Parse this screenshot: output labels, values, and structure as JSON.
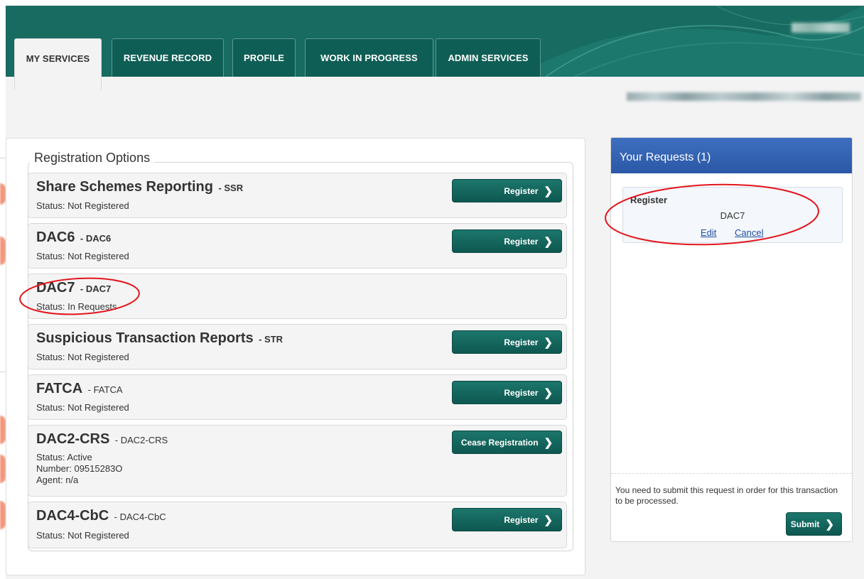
{
  "header": {
    "tabs": [
      {
        "label": "MY SERVICES",
        "active": true
      },
      {
        "label": "REVENUE RECORD",
        "active": false
      },
      {
        "label": "PROFILE",
        "active": false
      },
      {
        "label": "WORK IN PROGRESS",
        "active": false
      },
      {
        "label": "ADMIN SERVICES",
        "active": false
      }
    ]
  },
  "registration": {
    "legend": "Registration Options",
    "items": [
      {
        "name": "Share Schemes Reporting",
        "code": "- SSR",
        "status": "Status: Not Registered",
        "button": "Register"
      },
      {
        "name": "DAC6",
        "code": "- DAC6",
        "status": "Status: Not Registered",
        "button": "Register"
      },
      {
        "name": "DAC7",
        "code": "- DAC7",
        "status": "Status: In Requests"
      },
      {
        "name": "Suspicious Transaction Reports",
        "code": "- STR",
        "status": "Status: Not Registered",
        "button": "Register"
      },
      {
        "name": "FATCA",
        "code": "- FATCA",
        "status": "Status: Not Registered",
        "button": "Register"
      },
      {
        "name": "DAC2-CRS",
        "code": "- DAC2-CRS",
        "status": "Status: Active",
        "number": "Number: 09515283O",
        "agent": "Agent: n/a",
        "button": "Cease Registration"
      },
      {
        "name": "DAC4-CbC",
        "code": "- DAC4-CbC",
        "status": "Status: Not Registered",
        "button": "Register"
      }
    ]
  },
  "requests": {
    "title": "Your Requests (1)",
    "item": {
      "type": "Register",
      "name": "DAC7",
      "edit_label": "Edit",
      "cancel_label": "Cancel"
    },
    "note": "You need to submit this request in order for this transaction to be processed.",
    "submit_label": "Submit"
  },
  "colors": {
    "header_green": "#176b61",
    "tab_green": "#0f5e55",
    "button_green": "#145f57",
    "panel_blue": "#3362b3",
    "link_blue": "#1d4fa3",
    "annotation_red": "#e3141b"
  }
}
